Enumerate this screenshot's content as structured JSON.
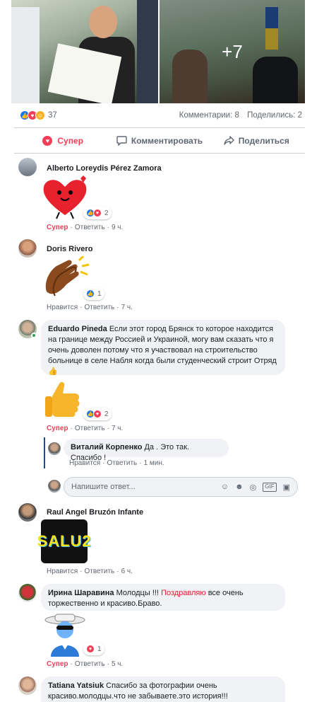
{
  "post": {
    "more_photos": "+7",
    "reaction_count": "37",
    "comments": "Комментарии: 8",
    "shares": "Поделились: 2"
  },
  "actions": {
    "super": "Супер",
    "comment": "Комментировать",
    "share": "Поделиться"
  },
  "comments": [
    {
      "name": "Alberto Loreydis Pérez Zamora",
      "react": "2",
      "reaction": "Супер",
      "reply": "Ответить",
      "time": "9 ч."
    },
    {
      "name": "Doris Rivero",
      "react": "1",
      "reaction": "Нравится",
      "reply": "Ответить",
      "time": "7 ч."
    },
    {
      "name": "Eduardo Pineda",
      "text": "Если этот город Брянск то которое находится на границе между Россией и Украиной, могу вам сказать что я очень доволен потому что я участвовал на строительство больнице в селе Набля когда были студенческий строит Отряд",
      "emoji": "👍",
      "react": "2",
      "reaction": "Супер",
      "reply": "Ответить",
      "time": "7 ч."
    },
    {
      "name": "Raul Angel Bruzón Infante",
      "sticker_text": "SALU2",
      "reaction": "Нравится",
      "reply": "Ответить",
      "time": "6 ч."
    },
    {
      "name": "Ирина Шаравина",
      "text_before": "Молодцы !!!",
      "link": "Поздравляю",
      "text_after": "все очень торжественно и красиво.Браво.",
      "react": "1",
      "reaction": "Супер",
      "reply": "Ответить",
      "time": "5 ч."
    },
    {
      "name": "Tatiana Yatsiuk",
      "text": "Спасибо за фотографии очень красиво.молодцы.что не забываете.это история!!!"
    }
  ],
  "reply": {
    "name": "Виталий Корпенко",
    "text": "Да . Это так. Спасибо !",
    "reaction": "Нравится",
    "reply": "Ответить",
    "time": "1 мин."
  },
  "reply_input": {
    "placeholder": "Напишите ответ..."
  }
}
